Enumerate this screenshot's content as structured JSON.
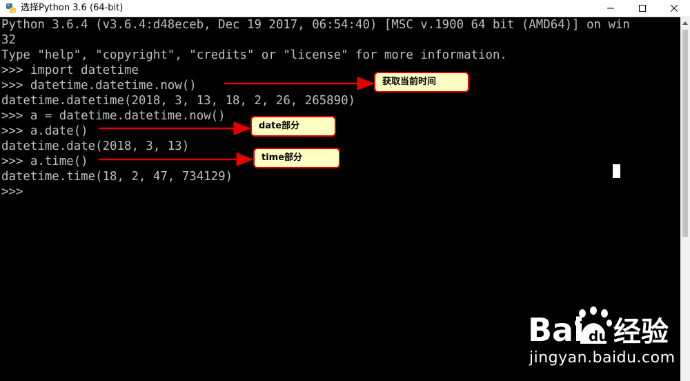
{
  "window": {
    "title": "选择Python 3.6 (64-bit)"
  },
  "console": {
    "lines": [
      "Python 3.6.4 (v3.6.4:d48eceb, Dec 19 2017, 06:54:40) [MSC v.1900 64 bit (AMD64)] on win",
      "32",
      "Type \"help\", \"copyright\", \"credits\" or \"license\" for more information.",
      ">>> import datetime",
      ">>> datetime.datetime.now()",
      "datetime.datetime(2018, 3, 13, 18, 2, 26, 265890)",
      ">>> a = datetime.datetime.now()",
      ">>> a.date()",
      "datetime.date(2018, 3, 13)",
      ">>> a.time()",
      "datetime.time(18, 2, 47, 734129)",
      ">>>"
    ]
  },
  "annotations": {
    "now_label": "获取当前时间",
    "date_label": "date部分",
    "time_label": "time部分"
  },
  "watermark": {
    "logo_text": "Bai 经验",
    "url": "jingyan.baidu.com"
  },
  "colors": {
    "console_text": "#c0c0c0",
    "console_bg": "#000000",
    "annotation_red": "#e60000",
    "annotation_fill": "#ffffc4"
  }
}
